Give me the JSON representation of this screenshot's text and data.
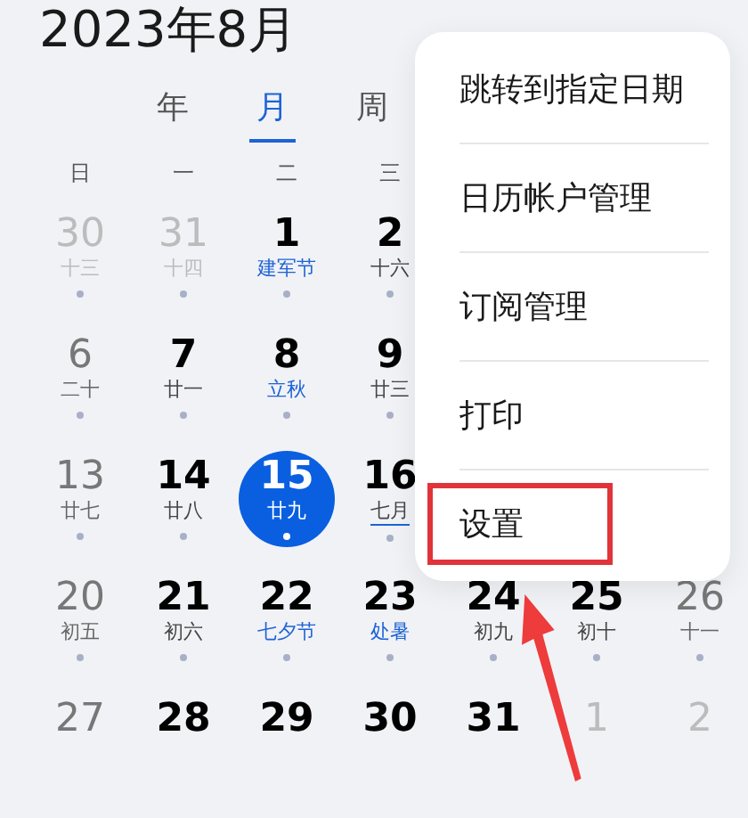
{
  "header": {
    "title": "2023年8月"
  },
  "view_tabs": [
    {
      "label": "年",
      "selected": false
    },
    {
      "label": "月",
      "selected": true
    },
    {
      "label": "周",
      "selected": false
    }
  ],
  "weekdays": [
    "日",
    "一",
    "二",
    "三"
  ],
  "weeks": [
    [
      {
        "day": "30",
        "lunar": "十三",
        "kind": "other",
        "festival": false,
        "underlined": false,
        "selected": false
      },
      {
        "day": "31",
        "lunar": "十四",
        "kind": "other",
        "festival": false,
        "underlined": false,
        "selected": false
      },
      {
        "day": "1",
        "lunar": "建军节",
        "kind": "weekday",
        "festival": true,
        "underlined": false,
        "selected": false
      },
      {
        "day": "2",
        "lunar": "十六",
        "kind": "weekday",
        "festival": false,
        "underlined": false,
        "selected": false
      }
    ],
    [
      {
        "day": "6",
        "lunar": "二十",
        "kind": "weekend",
        "festival": false,
        "underlined": false,
        "selected": false
      },
      {
        "day": "7",
        "lunar": "廿一",
        "kind": "weekday",
        "festival": false,
        "underlined": false,
        "selected": false
      },
      {
        "day": "8",
        "lunar": "立秋",
        "kind": "weekday",
        "festival": true,
        "underlined": false,
        "selected": false
      },
      {
        "day": "9",
        "lunar": "廿三",
        "kind": "weekday",
        "festival": false,
        "underlined": false,
        "selected": false
      }
    ],
    [
      {
        "day": "13",
        "lunar": "廿七",
        "kind": "weekend",
        "festival": false,
        "underlined": false,
        "selected": false
      },
      {
        "day": "14",
        "lunar": "廿八",
        "kind": "weekday",
        "festival": false,
        "underlined": false,
        "selected": false
      },
      {
        "day": "15",
        "lunar": "廿九",
        "kind": "weekday",
        "festival": false,
        "underlined": false,
        "selected": true
      },
      {
        "day": "16",
        "lunar": "七月",
        "kind": "weekday",
        "festival": false,
        "underlined": true,
        "selected": false
      }
    ],
    [
      {
        "day": "20",
        "lunar": "初五",
        "kind": "weekend",
        "festival": false,
        "underlined": false,
        "selected": false
      },
      {
        "day": "21",
        "lunar": "初六",
        "kind": "weekday",
        "festival": false,
        "underlined": false,
        "selected": false
      },
      {
        "day": "22",
        "lunar": "七夕节",
        "kind": "weekday",
        "festival": true,
        "underlined": false,
        "selected": false
      },
      {
        "day": "23",
        "lunar": "处暑",
        "kind": "weekday",
        "festival": true,
        "underlined": false,
        "selected": false
      },
      {
        "day": "24",
        "lunar": "初九",
        "kind": "weekday",
        "festival": false,
        "underlined": false,
        "selected": false
      },
      {
        "day": "25",
        "lunar": "初十",
        "kind": "weekday",
        "festival": false,
        "underlined": false,
        "selected": false
      },
      {
        "day": "26",
        "lunar": "十一",
        "kind": "weekend",
        "festival": false,
        "underlined": false,
        "selected": false
      }
    ],
    [
      {
        "day": "27",
        "kind": "weekend",
        "selected": false
      },
      {
        "day": "28",
        "kind": "weekday",
        "selected": false
      },
      {
        "day": "29",
        "kind": "weekday",
        "selected": false
      },
      {
        "day": "30",
        "kind": "weekday",
        "selected": false
      },
      {
        "day": "31",
        "kind": "weekday",
        "selected": false
      },
      {
        "day": "1",
        "kind": "other",
        "selected": false
      },
      {
        "day": "2",
        "kind": "other",
        "selected": false
      }
    ]
  ],
  "menu": {
    "items": [
      {
        "label": "跳转到指定日期",
        "highlighted": false
      },
      {
        "label": "日历帐户管理",
        "highlighted": false
      },
      {
        "label": "订阅管理",
        "highlighted": false
      },
      {
        "label": "打印",
        "highlighted": false
      },
      {
        "label": "设置",
        "highlighted": true
      }
    ]
  }
}
